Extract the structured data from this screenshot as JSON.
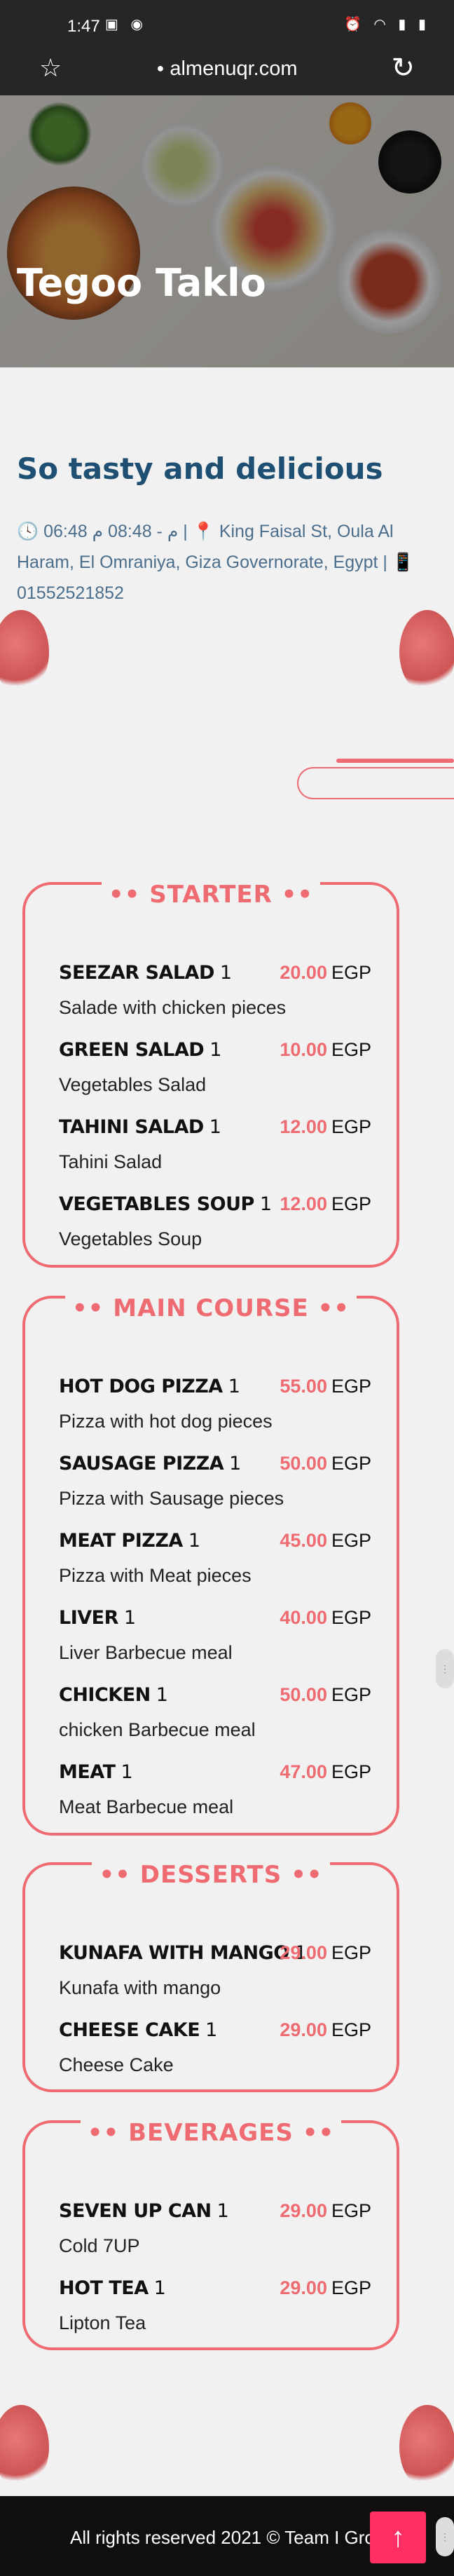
{
  "status": {
    "time": "1:47",
    "left_icons": "▣ ◉",
    "right_icons": "⏰ ◠ ▮ ▮"
  },
  "browser": {
    "url": "almenuqr.com"
  },
  "restaurant": {
    "name": "Tegoo Taklo",
    "tagline": "So tasty and delicious",
    "hours": "06:48 م - 08:48 م",
    "address": "King Faisal St, Oula Al Haram, El Omraniya, Giza Governorate, Egypt",
    "phone": "01552521852",
    "separator": "|"
  },
  "currency": "EGP",
  "categories": [
    {
      "title": "STARTER",
      "items": [
        {
          "name": "SEEZAR SALAD",
          "qty": "1",
          "price": "20.00",
          "desc": "Salade with chicken pieces"
        },
        {
          "name": "GREEN SALAD",
          "qty": "1",
          "price": "10.00",
          "desc": "Vegetables Salad"
        },
        {
          "name": "TAHINI SALAD",
          "qty": "1",
          "price": "12.00",
          "desc": "Tahini Salad"
        },
        {
          "name": "VEGETABLES SOUP",
          "qty": "1",
          "price": "12.00",
          "desc": "Vegetables Soup"
        }
      ]
    },
    {
      "title": "MAIN COURSE",
      "items": [
        {
          "name": "HOT DOG PIZZA",
          "qty": "1",
          "price": "55.00",
          "desc": "Pizza with hot dog pieces"
        },
        {
          "name": "SAUSAGE PIZZA",
          "qty": "1",
          "price": "50.00",
          "desc": "Pizza with Sausage pieces"
        },
        {
          "name": "MEAT PIZZA",
          "qty": "1",
          "price": "45.00",
          "desc": "Pizza with Meat pieces"
        },
        {
          "name": "LIVER",
          "qty": "1",
          "price": "40.00",
          "desc": "Liver Barbecue meal"
        },
        {
          "name": "CHICKEN",
          "qty": "1",
          "price": "50.00",
          "desc": "chicken Barbecue meal"
        },
        {
          "name": "MEAT",
          "qty": "1",
          "price": "47.00",
          "desc": "Meat Barbecue meal"
        }
      ]
    },
    {
      "title": "DESSERTS",
      "items": [
        {
          "name": "KUNAFA WITH MANGO",
          "qty": "1",
          "price": "29.00",
          "desc": "Kunafa with mango"
        },
        {
          "name": "CHEESE CAKE",
          "qty": "1",
          "price": "29.00",
          "desc": "Cheese Cake"
        }
      ]
    },
    {
      "title": "BEVERAGES",
      "items": [
        {
          "name": "SEVEN UP CAN",
          "qty": "1",
          "price": "29.00",
          "desc": "Cold 7UP"
        },
        {
          "name": "HOT TEA",
          "qty": "1",
          "price": "29.00",
          "desc": "Lipton Tea"
        }
      ]
    }
  ],
  "footer": {
    "copyright": "All rights reserved 2021 © Team I Grou"
  },
  "colors": {
    "accent": "#ef6b72",
    "title_blue": "#1f4f72",
    "scroll_top_bg": "#ff2e63"
  }
}
